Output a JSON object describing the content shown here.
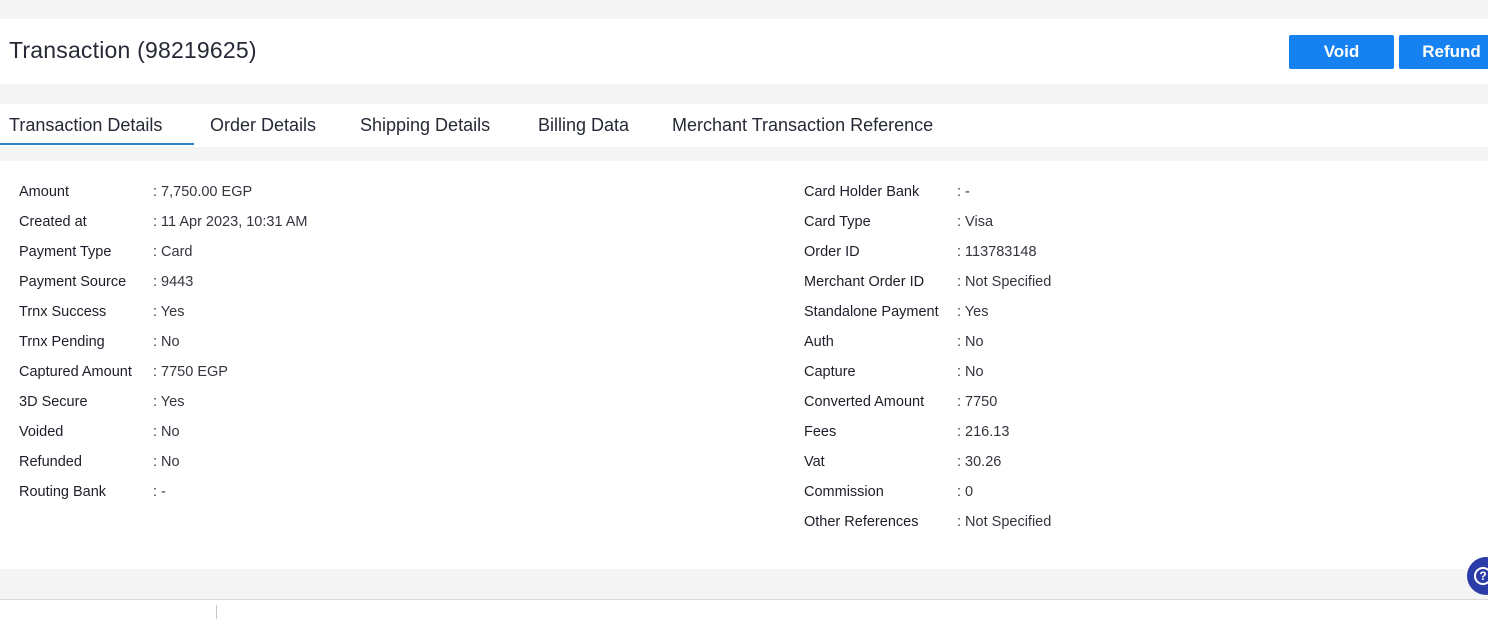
{
  "header": {
    "title": "Transaction (98219625)",
    "void_label": "Void",
    "refund_label": "Refund"
  },
  "tabs": [
    {
      "label": "Transaction Details",
      "active": true
    },
    {
      "label": "Order Details",
      "active": false
    },
    {
      "label": "Shipping Details",
      "active": false
    },
    {
      "label": "Billing Data",
      "active": false
    },
    {
      "label": "Merchant Transaction Reference",
      "active": false
    }
  ],
  "details": {
    "left": [
      {
        "label": "Amount",
        "value": ": 7,750.00 EGP"
      },
      {
        "label": "Created at",
        "value": ": 11 Apr 2023, 10:31 AM"
      },
      {
        "label": "Payment Type",
        "value": ": Card"
      },
      {
        "label": "Payment Source",
        "value": ": 9443"
      },
      {
        "label": "Trnx Success",
        "value": ": Yes"
      },
      {
        "label": "Trnx Pending",
        "value": ": No"
      },
      {
        "label": "Captured Amount",
        "value": ": 7750 EGP"
      },
      {
        "label": "3D Secure",
        "value": ": Yes"
      },
      {
        "label": "Voided",
        "value": ": No"
      },
      {
        "label": "Refunded",
        "value": ": No"
      },
      {
        "label": "Routing Bank",
        "value": ": -"
      }
    ],
    "right": [
      {
        "label": "Card Holder Bank",
        "value": ": -"
      },
      {
        "label": "Card Type",
        "value": ": Visa"
      },
      {
        "label": "Order ID",
        "value": ": 113783148"
      },
      {
        "label": "Merchant Order ID",
        "value": ": Not Specified"
      },
      {
        "label": "Standalone Payment",
        "value": ": Yes"
      },
      {
        "label": "Auth",
        "value": ": No"
      },
      {
        "label": "Capture",
        "value": ": No"
      },
      {
        "label": "Converted Amount",
        "value": ": 7750"
      },
      {
        "label": "Fees",
        "value": ": 216.13"
      },
      {
        "label": "Vat",
        "value": ": 30.26"
      },
      {
        "label": "Commission",
        "value": ": 0"
      },
      {
        "label": "Other References",
        "value": ": Not Specified"
      }
    ]
  },
  "help": {
    "glyph": "?"
  },
  "colors": {
    "primary_button": "#1681f0",
    "active_tab_underline": "#2f7fd1",
    "help_button": "#2a3ca8"
  }
}
